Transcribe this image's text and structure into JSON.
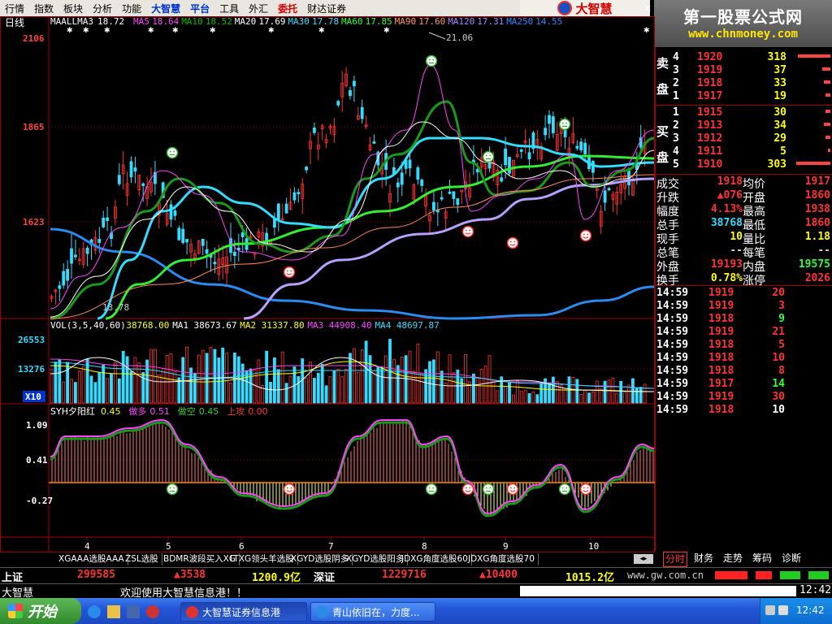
{
  "menu": {
    "items": [
      "行情",
      "指数",
      "板块",
      "分析",
      "功能",
      "大智慧",
      "平台",
      "工具",
      "外汇",
      "委托",
      "财达证券"
    ],
    "close": "×"
  },
  "brand": "大智慧",
  "banner": {
    "title": "第一股票公式网",
    "url": "www.chnmoney.com"
  },
  "price_panel": {
    "period": "日线",
    "ma_prefix": "MAALLMA3",
    "ma_labels": [
      {
        "name": "MA3",
        "value": "18.72",
        "color": "#ffffff"
      },
      {
        "name": "MA5",
        "value": "18.64",
        "color": "#ff44ff"
      },
      {
        "name": "MA10",
        "value": "18.52",
        "color": "#00bb00"
      },
      {
        "name": "MA20",
        "value": "17.69",
        "color": "#ffffff"
      },
      {
        "name": "MA30",
        "value": "17.78",
        "color": "#33ddff"
      },
      {
        "name": "MA60",
        "value": "17.85",
        "color": "#33ff33"
      },
      {
        "name": "MA90",
        "value": "17.60",
        "color": "#ff9966"
      },
      {
        "name": "MA120",
        "value": "17.31",
        "color": "#aa88ff"
      },
      {
        "name": "MA250",
        "value": "14.55",
        "color": "#3388ff"
      }
    ],
    "y_ticks": [
      "2106",
      "1865",
      "1623"
    ],
    "high_label": "21.06",
    "low_label": "13.78"
  },
  "vol_panel": {
    "legend": [
      {
        "text": "VOL(3,5,40,60)",
        "color": "#ffffff"
      },
      {
        "text": "38768.00",
        "color": "#ffff00"
      },
      {
        "text": "MA1",
        "color": "#ffffff"
      },
      {
        "text": "38673.67",
        "color": "#ffffff"
      },
      {
        "text": "MA2",
        "color": "#ffff00"
      },
      {
        "text": "31337.80",
        "color": "#ffff00"
      },
      {
        "text": "MA3",
        "color": "#ff44ff"
      },
      {
        "text": "44908.40",
        "color": "#ff44ff"
      },
      {
        "text": "MA4",
        "color": "#33ddff"
      },
      {
        "text": "48697.87",
        "color": "#33ddff"
      }
    ],
    "y_ticks": [
      "26553",
      "13276"
    ],
    "unit": "X10"
  },
  "ind_panel": {
    "legend": [
      {
        "text": "SYH夕阳红",
        "color": "#ffffff"
      },
      {
        "text": "0.45",
        "color": "#ffff00"
      },
      {
        "text": "做多",
        "color": "#ff44ff"
      },
      {
        "text": "0.51",
        "color": "#ff44ff"
      },
      {
        "text": "做空",
        "color": "#33cc33"
      },
      {
        "text": "0.45",
        "color": "#33cc33"
      },
      {
        "text": "上攻",
        "color": "#ff3333"
      },
      {
        "text": "0.00",
        "color": "#ff3333"
      }
    ],
    "y_ticks": [
      "1.09",
      "0.41",
      "-0.27"
    ]
  },
  "x_ticks": [
    "4",
    "5",
    "6",
    "7",
    "8",
    "9",
    "10"
  ],
  "order_book": {
    "sell_label": "卖盘",
    "buy_label": "买盘",
    "sell": [
      {
        "level": "4",
        "price": "1920",
        "vol": "318"
      },
      {
        "level": "3",
        "price": "1919",
        "vol": "37"
      },
      {
        "level": "2",
        "price": "1918",
        "vol": "33"
      },
      {
        "level": "1",
        "price": "1917",
        "vol": "19"
      }
    ],
    "buy": [
      {
        "level": "1",
        "price": "1915",
        "vol": "30"
      },
      {
        "level": "2",
        "price": "1913",
        "vol": "34"
      },
      {
        "level": "3",
        "price": "1912",
        "vol": "29"
      },
      {
        "level": "4",
        "price": "1911",
        "vol": "5"
      },
      {
        "level": "5",
        "price": "1910",
        "vol": "303"
      }
    ]
  },
  "stats": [
    {
      "l1": "成交",
      "v1": "1918",
      "c1": "#ff3333",
      "l2": "均价",
      "v2": "1917",
      "c2": "#ff3333"
    },
    {
      "l1": "升跌",
      "v1": "▲076",
      "c1": "#ff3333",
      "l2": "开盘",
      "v2": "1860",
      "c2": "#ff3333"
    },
    {
      "l1": "幅度",
      "v1": "4.13%",
      "c1": "#ff3333",
      "l2": "最高",
      "v2": "1938",
      "c2": "#ff3333"
    },
    {
      "l1": "总手",
      "v1": "38768",
      "c1": "#33ddff",
      "l2": "最低",
      "v2": "1860",
      "c2": "#ff3333"
    },
    {
      "l1": "现手",
      "v1": "10",
      "c1": "#ffff00",
      "l2": "量比",
      "v2": "1.18",
      "c2": "#ffff00"
    },
    {
      "l1": "总笔",
      "v1": "--",
      "c1": "#cccccc",
      "l2": "每笔",
      "v2": "--",
      "c2": "#cccccc"
    },
    {
      "l1": "外盘",
      "v1": "19193",
      "c1": "#ff3333",
      "l2": "内盘",
      "v2": "19575",
      "c2": "#33ff33"
    },
    {
      "l1": "换手",
      "v1": "0.78%",
      "c1": "#ffff00",
      "l2": "涨停",
      "v2": "2026",
      "c2": "#ff3333"
    }
  ],
  "ticks": [
    {
      "time": "14:59",
      "price": "1919",
      "vol": "20",
      "vc": "#ff3333"
    },
    {
      "time": "14:59",
      "price": "1919",
      "vol": "3",
      "vc": "#ff3333"
    },
    {
      "time": "14:59",
      "price": "1918",
      "vol": "9",
      "vc": "#33ff33"
    },
    {
      "time": "14:59",
      "price": "1919",
      "vol": "21",
      "vc": "#ff3333"
    },
    {
      "time": "14:59",
      "price": "1918",
      "vol": "5",
      "vc": "#ff3333"
    },
    {
      "time": "14:59",
      "price": "1918",
      "vol": "10",
      "vc": "#ff3333"
    },
    {
      "time": "14:59",
      "price": "1918",
      "vol": "8",
      "vc": "#ff3333"
    },
    {
      "time": "14:59",
      "price": "1917",
      "vol": "14",
      "vc": "#33ff33"
    },
    {
      "time": "14:59",
      "price": "1919",
      "vol": "30",
      "vc": "#ff3333"
    },
    {
      "time": "14:59",
      "price": "1918",
      "vol": "10",
      "vc": "#ffffff"
    }
  ],
  "formula_tabs": [
    "XGAAA选股AAA",
    "ZSL选股",
    "BDMR波段买入XG",
    "LTXG领头羊选股",
    "XGYD选股阴多",
    "XGYD选股阳多",
    "JDXG角度选股60",
    "JDXG角度选股70"
  ],
  "right_tabs": [
    "分时",
    "财务",
    "走势",
    "筹码",
    "诊断"
  ],
  "index_bar": {
    "sh_label": "上证",
    "sh_value": "299585",
    "sh_change": "▲3538",
    "sh_amount": "1200.9亿",
    "sz_label": "深证",
    "sz_value": "1229716",
    "sz_change": "▲10400",
    "sz_amount": "1015.2亿",
    "url": "www.gw.com.cn"
  },
  "status_bar": {
    "app": "大智慧",
    "message": "欢迎使用大智慧信息港！！",
    "time": "12:42"
  },
  "taskbar": {
    "start": "开始",
    "items": [
      "大智慧证券信息港",
      "青山依旧在，力度..."
    ],
    "clock": "12:42"
  },
  "chart_data": {
    "type": "candlestick",
    "note": "",
    "y_range": [
      13.5,
      21.5
    ],
    "ma_curves": [
      {
        "name": "MA250",
        "color": "#3388ff"
      },
      {
        "name": "MA120",
        "color": "#aa88ff"
      },
      {
        "name": "MA60",
        "color": "#33ff33"
      },
      {
        "name": "MA30",
        "color": "#33ddff"
      },
      {
        "name": "MA10",
        "color": "#00bb00"
      }
    ]
  }
}
